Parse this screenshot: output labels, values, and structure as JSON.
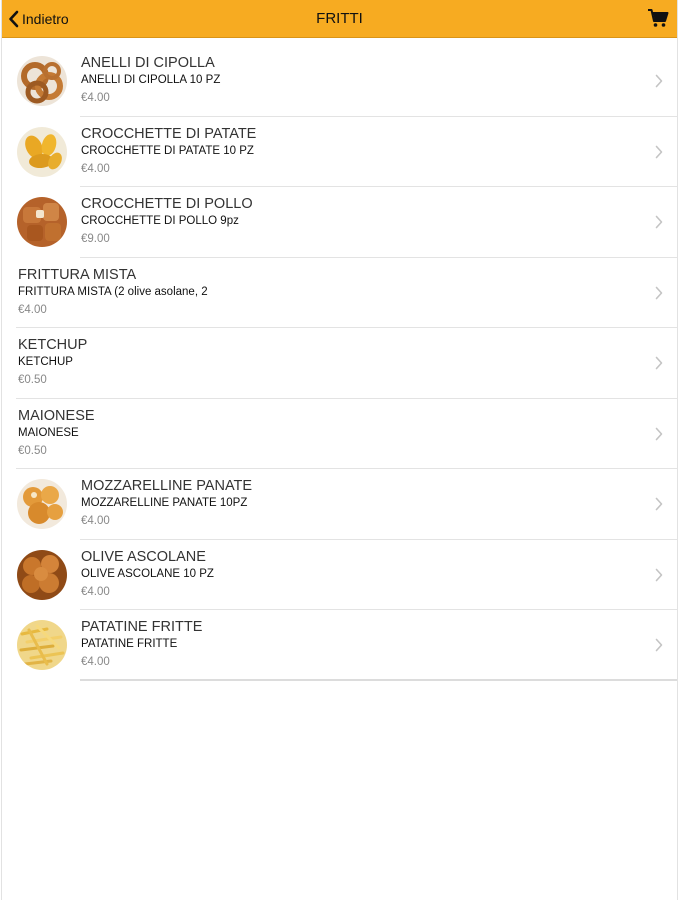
{
  "header": {
    "back_label": "Indietro",
    "title": "FRITTI",
    "cart_icon": "cart-icon",
    "background_color": "#f7ab21"
  },
  "products": [
    {
      "name": "ANELLI DI CIPOLLA",
      "description": "ANELLI DI CIPOLLA 10 PZ",
      "price": "€4.00",
      "image": "onion-rings"
    },
    {
      "name": "CROCCHETTE DI PATATE",
      "description": "CROCCHETTE DI PATATE 10 PZ",
      "price": "€4.00",
      "image": "potato-croquettes"
    },
    {
      "name": "CROCCHETTE DI POLLO",
      "description": "CROCCHETTE DI POLLO 9pz",
      "price": "€9.00",
      "image": "chicken-croquettes"
    },
    {
      "name": "FRITTURA MISTA",
      "description": "FRITTURA MISTA (2 olive asolane, 2",
      "price": "€4.00",
      "image": null
    },
    {
      "name": "KETCHUP",
      "description": "KETCHUP",
      "price": "€0.50",
      "image": null
    },
    {
      "name": "MAIONESE",
      "description": "MAIONESE",
      "price": "€0.50",
      "image": null
    },
    {
      "name": "MOZZARELLINE PANATE",
      "description": "MOZZARELLINE PANATE 10PZ",
      "price": "€4.00",
      "image": "fried-mozzarella"
    },
    {
      "name": "OLIVE ASCOLANE",
      "description": "OLIVE ASCOLANE 10 PZ",
      "price": "€4.00",
      "image": "stuffed-olives"
    },
    {
      "name": "PATATINE FRITTE",
      "description": "PATATINE FRITTE",
      "price": "€4.00",
      "image": "french-fries"
    }
  ]
}
